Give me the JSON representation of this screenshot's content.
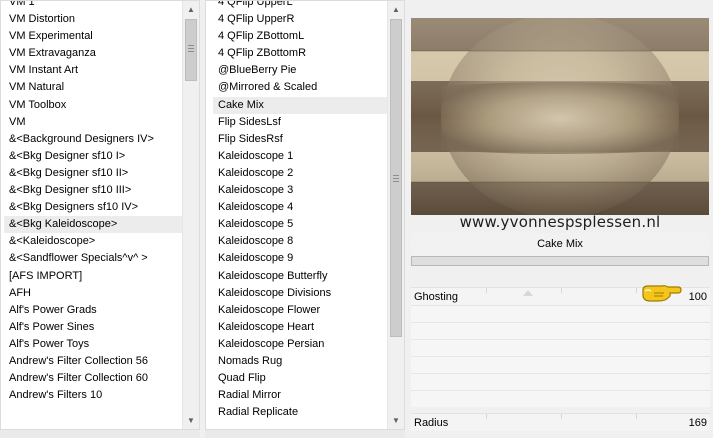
{
  "categories": {
    "items": [
      {
        "label": "VM 1"
      },
      {
        "label": "VM Distortion"
      },
      {
        "label": "VM Experimental"
      },
      {
        "label": "VM Extravaganza"
      },
      {
        "label": "VM Instant Art"
      },
      {
        "label": "VM Natural"
      },
      {
        "label": "VM Toolbox"
      },
      {
        "label": "VM"
      },
      {
        "label": "&<Background Designers IV>"
      },
      {
        "label": "&<Bkg Designer sf10 I>"
      },
      {
        "label": "&<Bkg Designer sf10 II>"
      },
      {
        "label": "&<Bkg Designer sf10 III>"
      },
      {
        "label": "&<Bkg Designers sf10 IV>"
      },
      {
        "label": "&<Bkg Kaleidoscope>"
      },
      {
        "label": "&<Kaleidoscope>"
      },
      {
        "label": "&<Sandflower Specials^v^ >"
      },
      {
        "label": "[AFS IMPORT]"
      },
      {
        "label": "AFH"
      },
      {
        "label": "Alf's Power Grads"
      },
      {
        "label": "Alf's Power Sines"
      },
      {
        "label": "Alf's Power Toys"
      },
      {
        "label": "Andrew's Filter Collection 56"
      },
      {
        "label": "Andrew's Filter Collection 60"
      },
      {
        "label": "Andrew's Filters 10"
      }
    ],
    "selected": "&<Bkg Kaleidoscope>"
  },
  "filters": {
    "items": [
      {
        "label": "4 QFlip UpperL"
      },
      {
        "label": "4 QFlip UpperR"
      },
      {
        "label": "4 QFlip ZBottomL"
      },
      {
        "label": "4 QFlip ZBottomR"
      },
      {
        "label": "@BlueBerry Pie"
      },
      {
        "label": "@Mirrored & Scaled"
      },
      {
        "label": "Cake Mix"
      },
      {
        "label": "Flip SidesLsf"
      },
      {
        "label": "Flip SidesRsf"
      },
      {
        "label": "Kaleidoscope 1"
      },
      {
        "label": "Kaleidoscope 2"
      },
      {
        "label": "Kaleidoscope 3"
      },
      {
        "label": "Kaleidoscope 4"
      },
      {
        "label": "Kaleidoscope 5"
      },
      {
        "label": "Kaleidoscope 8"
      },
      {
        "label": "Kaleidoscope 9"
      },
      {
        "label": "Kaleidoscope Butterfly"
      },
      {
        "label": "Kaleidoscope Divisions"
      },
      {
        "label": "Kaleidoscope Flower"
      },
      {
        "label": "Kaleidoscope Heart"
      },
      {
        "label": "Kaleidoscope Persian"
      },
      {
        "label": "Nomads Rug"
      },
      {
        "label": "Quad Flip"
      },
      {
        "label": "Radial Mirror"
      },
      {
        "label": "Radial Replicate"
      }
    ],
    "selected": "Cake Mix"
  },
  "preview": {
    "watermark": "www.yvonnespsplessen.nl",
    "colors": {
      "dark": "#6b5844",
      "light": "#cdbd9b",
      "highlight": "#e8dcc2"
    }
  },
  "filter_title": "Cake Mix",
  "parameters": [
    {
      "label": "Ghosting",
      "value": "100"
    },
    {
      "label": "Radius",
      "value": "169"
    }
  ],
  "pointer_icon": "pointing-hand-icon"
}
